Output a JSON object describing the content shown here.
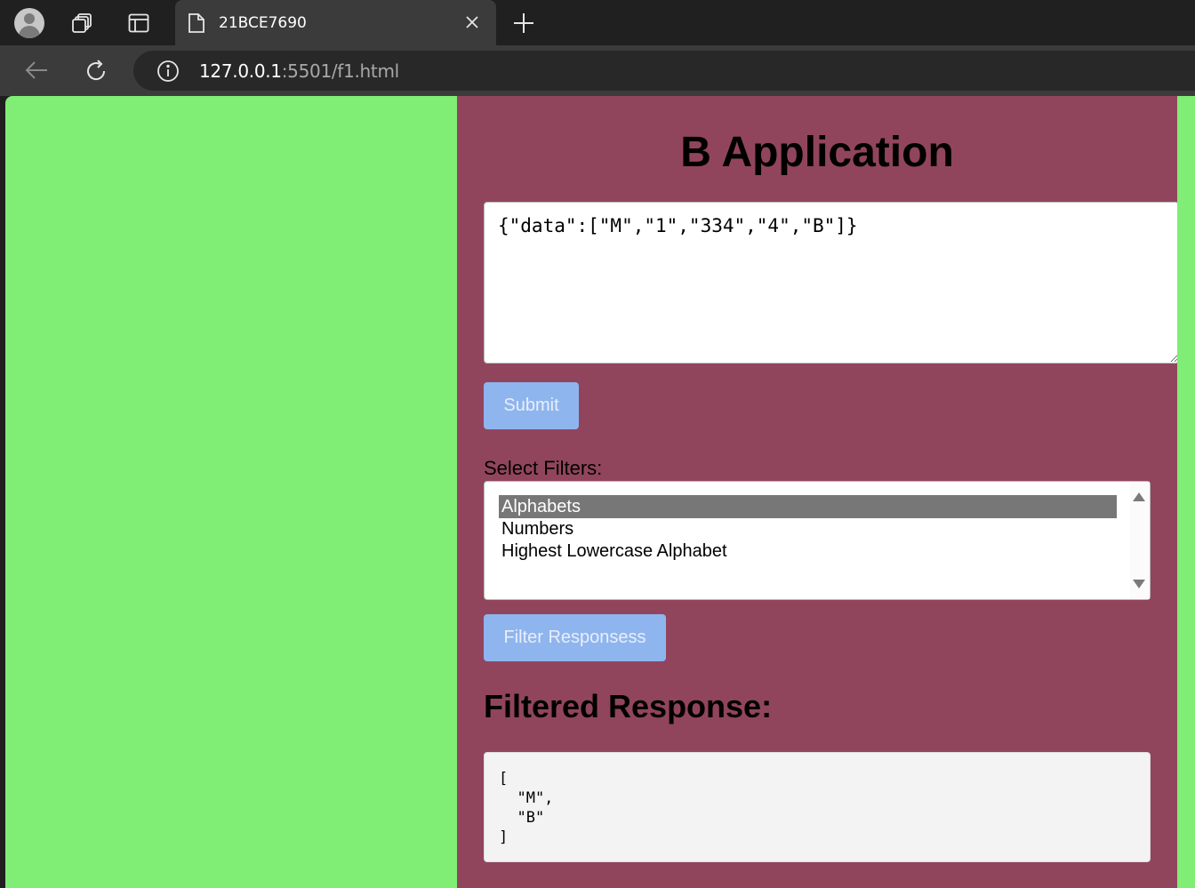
{
  "browser": {
    "tab_title": "21BCE7690",
    "url_host": "127.0.0.1",
    "url_rest": ":5501/f1.html"
  },
  "page": {
    "title": "B Application",
    "json_input_value": "{\"data\":[\"M\",\"1\",\"334\",\"4\",\"B\"]}",
    "submit_label": "Submit",
    "filter_label": "Select Filters:",
    "filter_options": [
      {
        "label": "Alphabets",
        "selected": true
      },
      {
        "label": "Numbers",
        "selected": false
      },
      {
        "label": "Highest Lowercase Alphabet",
        "selected": false
      }
    ],
    "filter_button_label": "Filter Responsess",
    "response_heading": "Filtered Response:",
    "response_text": "[\n  \"M\",\n  \"B\"\n]"
  },
  "colors": {
    "page_bg": "#80ed74",
    "container_bg": "#91455d",
    "button_bg": "#8fb5ee",
    "selected_option_bg": "#777777"
  }
}
